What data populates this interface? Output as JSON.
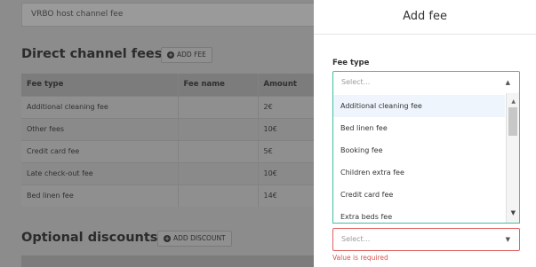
{
  "background": {
    "channel_input_value": "VRBO host channel fee",
    "direct_fees": {
      "heading": "Direct channel fees",
      "help_icon": "question-circle-icon",
      "add_button": "ADD FEE",
      "columns": [
        "Fee type",
        "Fee name",
        "Amount"
      ],
      "rows": [
        [
          "Additional cleaning fee",
          "",
          "2€"
        ],
        [
          "Other fees",
          "",
          "10€"
        ],
        [
          "Credit card fee",
          "",
          "5€"
        ],
        [
          "Late check-out fee",
          "",
          "10€"
        ],
        [
          "Bed linen fee",
          "",
          "14€"
        ]
      ]
    },
    "optional_discounts": {
      "heading": "Optional discounts",
      "help_icon": "question-circle-icon",
      "add_button": "ADD DISCOUNT"
    }
  },
  "panel": {
    "title": "Add fee",
    "fee_type": {
      "label": "Fee type",
      "placeholder": "Select...",
      "options": [
        "Additional cleaning fee",
        "Bed linen fee",
        "Booking fee",
        "Children extra fee",
        "Credit card fee",
        "Extra beds fee"
      ],
      "highlighted_index": 0
    },
    "second_select": {
      "placeholder": "Select...",
      "error": "Value is required"
    }
  },
  "colors": {
    "accent": "#40bfa0",
    "error": "#e06060"
  }
}
